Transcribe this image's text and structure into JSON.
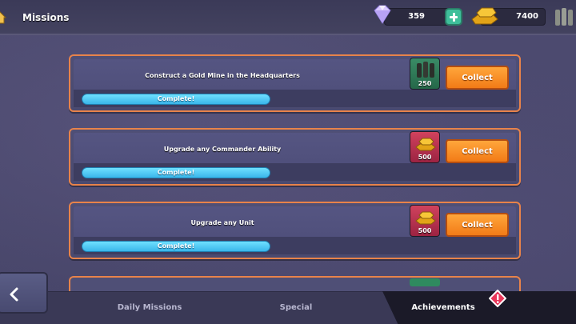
{
  "header": {
    "title": "Missions",
    "gems": "359",
    "gold": "7400"
  },
  "missions": [
    {
      "description": "Construct a Gold Mine in the Headquarters",
      "progress_label": "Complete!",
      "progress": 1.0,
      "reward_icon": "ammo-icon",
      "reward_amount": "250",
      "collect_label": "Collect"
    },
    {
      "description": "Upgrade any Commander Ability",
      "progress_label": "Complete!",
      "progress": 1.0,
      "reward_icon": "gold-bars-icon",
      "reward_amount": "500",
      "collect_label": "Collect"
    },
    {
      "description": "Upgrade any Unit",
      "progress_label": "Complete!",
      "progress": 1.0,
      "reward_icon": "gold-bars-icon",
      "reward_amount": "500",
      "collect_label": "Collect"
    }
  ],
  "tabs": [
    {
      "label": "Daily Missions",
      "active": false
    },
    {
      "label": "Special",
      "active": false
    },
    {
      "label": "Achievements",
      "active": true
    }
  ],
  "colors": {
    "accent_orange": "#f27b17",
    "progress_blue": "#3ab6ea",
    "panel_border": "#e8834a"
  }
}
